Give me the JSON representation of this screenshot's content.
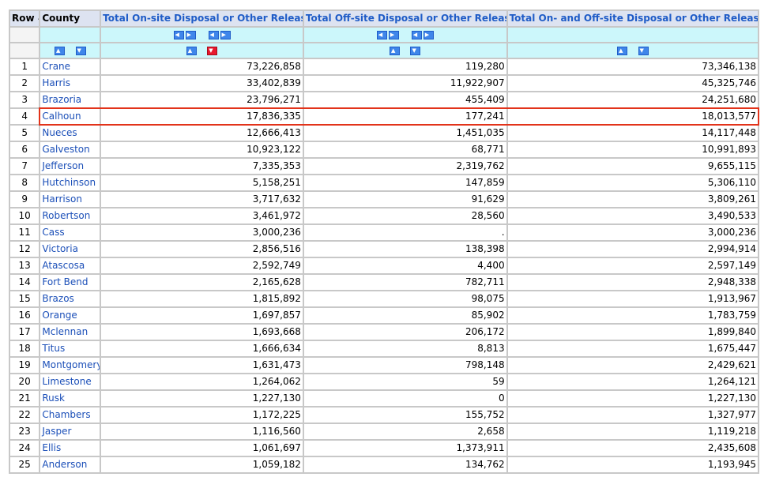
{
  "table": {
    "headers": [
      "Row #",
      "County",
      "Total On-site Disposal or Other Releases",
      "Total Off-site Disposal or Other Releases",
      "Total On- and Off-site Disposal or Other Releases"
    ],
    "icons": {
      "move_left": "move-left-icon",
      "move_right": "move-right-icon",
      "sort_up": "sort-ascending-icon",
      "sort_down": "sort-descending-icon",
      "active_sort_color": "#e8182d",
      "icon_color": "#3f86ea"
    },
    "rows": [
      [
        "1",
        "Crane",
        "73,226,858",
        "119,280",
        "73,346,138"
      ],
      [
        "2",
        "Harris",
        "33,402,839",
        "11,922,907",
        "45,325,746"
      ],
      [
        "3",
        "Brazoria",
        "23,796,271",
        "455,409",
        "24,251,680"
      ],
      [
        "4",
        "Calhoun",
        "17,836,335",
        "177,241",
        "18,013,577"
      ],
      [
        "5",
        "Nueces",
        "12,666,413",
        "1,451,035",
        "14,117,448"
      ],
      [
        "6",
        "Galveston",
        "10,923,122",
        "68,771",
        "10,991,893"
      ],
      [
        "7",
        "Jefferson",
        "7,335,353",
        "2,319,762",
        "9,655,115"
      ],
      [
        "8",
        "Hutchinson",
        "5,158,251",
        "147,859",
        "5,306,110"
      ],
      [
        "9",
        "Harrison",
        "3,717,632",
        "91,629",
        "3,809,261"
      ],
      [
        "10",
        "Robertson",
        "3,461,972",
        "28,560",
        "3,490,533"
      ],
      [
        "11",
        "Cass",
        "3,000,236",
        ".",
        "3,000,236"
      ],
      [
        "12",
        "Victoria",
        "2,856,516",
        "138,398",
        "2,994,914"
      ],
      [
        "13",
        "Atascosa",
        "2,592,749",
        "4,400",
        "2,597,149"
      ],
      [
        "14",
        "Fort Bend",
        "2,165,628",
        "782,711",
        "2,948,338"
      ],
      [
        "15",
        "Brazos",
        "1,815,892",
        "98,075",
        "1,913,967"
      ],
      [
        "16",
        "Orange",
        "1,697,857",
        "85,902",
        "1,783,759"
      ],
      [
        "17",
        "Mclennan",
        "1,693,668",
        "206,172",
        "1,899,840"
      ],
      [
        "18",
        "Titus",
        "1,666,634",
        "8,813",
        "1,675,447"
      ],
      [
        "19",
        "Montgomery",
        "1,631,473",
        "798,148",
        "2,429,621"
      ],
      [
        "20",
        "Limestone",
        "1,264,062",
        "59",
        "1,264,121"
      ],
      [
        "21",
        "Rusk",
        "1,227,130",
        "0",
        "1,227,130"
      ],
      [
        "22",
        "Chambers",
        "1,172,225",
        "155,752",
        "1,327,977"
      ],
      [
        "23",
        "Jasper",
        "1,116,560",
        "2,658",
        "1,119,218"
      ],
      [
        "24",
        "Ellis",
        "1,061,697",
        "1,373,911",
        "2,435,608"
      ],
      [
        "25",
        "Anderson",
        "1,059,182",
        "134,762",
        "1,193,945"
      ]
    ],
    "highlighted_row": 4,
    "highlight_color": "#e2331a"
  }
}
